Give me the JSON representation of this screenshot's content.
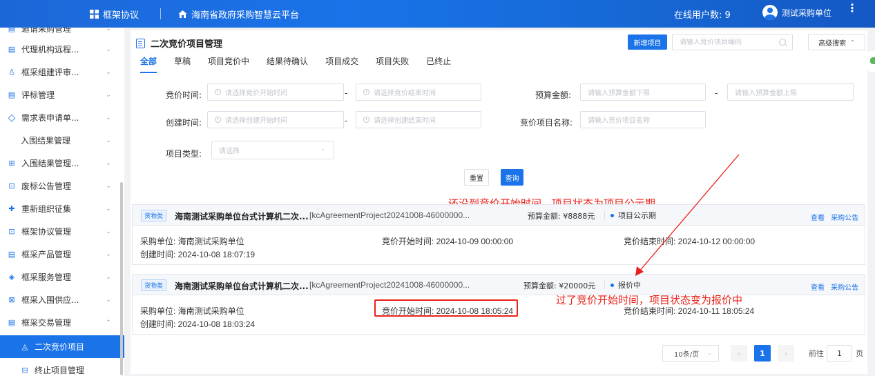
{
  "topbar": {
    "system_name": "框架协议",
    "platform_name": "海南省政府采购智慧云平台",
    "online_label": "在线用户数: 9",
    "user_name": "测试采购单位",
    "more_glyph": "⋮"
  },
  "sidebar": {
    "items": [
      {
        "label": "邀请采购管理",
        "icon": "▤",
        "chevron": "⌄"
      },
      {
        "label": "代理机构远程...",
        "icon": "▤",
        "chevron": "⌄"
      },
      {
        "label": "框采组建评审...",
        "icon": "♙",
        "chevron": "⌄"
      },
      {
        "label": "评标管理",
        "icon": "▤",
        "chevron": "⌄"
      },
      {
        "label": "需求表申请单...",
        "icon": "◇",
        "chevron": "⌄"
      },
      {
        "label": "入围结果管理",
        "icon": "",
        "chevron": "⌄"
      },
      {
        "label": "入围结果管理...",
        "icon": "⊞",
        "chevron": "⌄"
      },
      {
        "label": "废标公告管理",
        "icon": "⊡",
        "chevron": "⌄"
      },
      {
        "label": "重新组织征集",
        "icon": "✚",
        "chevron": "⌄"
      },
      {
        "label": "框架协议管理",
        "icon": "⊡",
        "chevron": "⌄"
      },
      {
        "label": "框采产品管理",
        "icon": "▤",
        "chevron": "⌄"
      },
      {
        "label": "框采服务管理",
        "icon": "◈",
        "chevron": "⌄"
      },
      {
        "label": "框采入围供应...",
        "icon": "⊠",
        "chevron": "⌄"
      },
      {
        "label": "框采交易管理",
        "icon": "▤",
        "chevron": "⌃"
      },
      {
        "label": "二次竞价项目",
        "icon": "◬",
        "chevron": ""
      },
      {
        "label": "终止项目管理",
        "icon": "⊟",
        "chevron": ""
      }
    ]
  },
  "main": {
    "title": "二次竞价项目管理",
    "new_button": "新增项目",
    "search_placeholder": "请输入竞价项目编码",
    "advanced_search": "高级搜索",
    "advanced_caret": "⌃",
    "tabs": [
      "全部",
      "草稿",
      "项目竞价中",
      "结果待确认",
      "项目成交",
      "项目失败",
      "已终止"
    ],
    "filters": {
      "bid_time_label": "竞价时间:",
      "bid_start_placeholder": "请选择竞价开始时间",
      "bid_end_placeholder": "请选择竞价结束时间",
      "budget_label": "预算金额:",
      "budget_min_placeholder": "请输入预算金额下限",
      "budget_max_placeholder": "请输入预算金额上限",
      "create_time_label": "创建时间:",
      "create_start_placeholder": "请选择创建开始时间",
      "create_end_placeholder": "请选择创建结束时间",
      "project_name_label": "竞价项目名称:",
      "project_name_placeholder": "请输入竞价项目名称",
      "project_type_label": "项目类型:",
      "project_type_placeholder": "请选择",
      "range_dash": "-",
      "select_caret": "⌄"
    },
    "reset_button": "重置",
    "query_button": "查询",
    "records": [
      {
        "tag": "货物类",
        "name": "海南测试采购单位台式计算机二次...",
        "code": "[kcAgreementProject20241008-46000000...",
        "budget": "预算金额: ¥8888元",
        "status": "项目公示期",
        "view": "查看",
        "notice": "采购公告",
        "purchaser": "采购单位: 海南测试采购单位",
        "bid_start": "竞价开始时间: 2024-10-09 00:00:00",
        "bid_end": "竞价结束时间: 2024-10-12 00:00:00",
        "created": "创建时间: 2024-10-08 18:07:19"
      },
      {
        "tag": "货物类",
        "name": "海南测试采购单位台式计算机二次...",
        "code": "[kcAgreementProject20241008-46000000...",
        "budget": "预算金额: ¥20000元",
        "status": "报价中",
        "view": "查看",
        "notice": "采购公告",
        "purchaser": "采购单位: 海南测试采购单位",
        "bid_start": "竞价开始时间: 2024-10-08 18:05:24",
        "bid_end": "竞价结束时间: 2024-10-11 18:05:24",
        "created": "创建时间: 2024-10-08 18:03:24"
      }
    ],
    "annotations": {
      "first": "还没到竞价开始时间，项目状态为项目公示期",
      "second": "过了竞价开始时间，项目状态变为报价中"
    },
    "pagination": {
      "page_size": "10条/页",
      "size_caret": "⌄",
      "prev": "‹",
      "current_page": "1",
      "next": "›",
      "goto_prefix": "前往",
      "goto_value": "1",
      "goto_suffix": "页"
    }
  },
  "colors": {
    "primary": "#1a73e8",
    "annotation_red": "#e8211a"
  }
}
